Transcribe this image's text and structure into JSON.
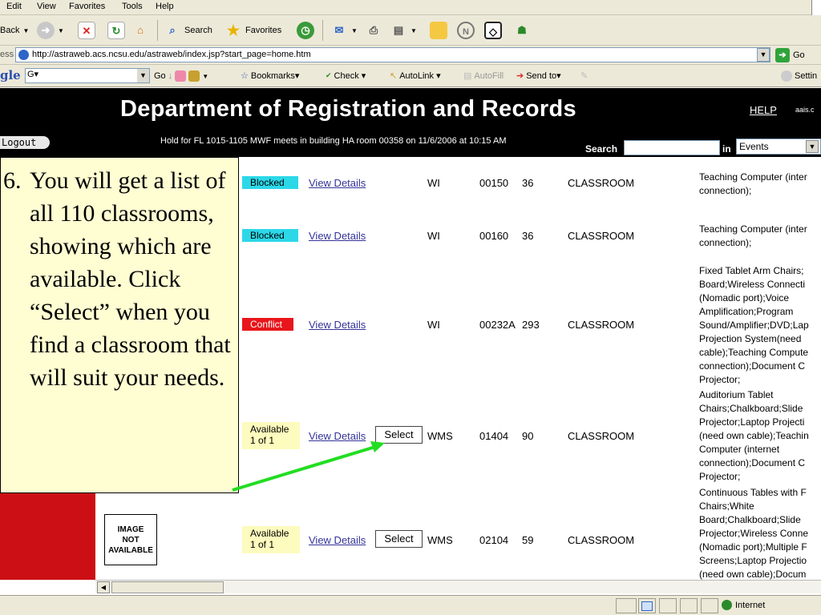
{
  "browser": {
    "menu": [
      "Edit",
      "View",
      "Favorites",
      "Tools",
      "Help"
    ],
    "toolbar": {
      "back": "Back",
      "search": "Search",
      "favorites": "Favorites"
    },
    "address": {
      "label": "ess",
      "url": "http://astraweb.acs.ncsu.edu/astraweb/index.jsp?start_page=home.htm",
      "go": "Go"
    },
    "google": {
      "logo": "gle",
      "box_value": "G▾",
      "go": "Go",
      "bookmarks": "Bookmarks▾",
      "check": "Check ▾",
      "autolink": "AutoLink ▾",
      "autofill": "AutoFill",
      "sendto": "Send to▾",
      "settings": "Settin"
    },
    "status": {
      "zone": "Internet"
    }
  },
  "page": {
    "title": "Department of Registration and Records",
    "help": "HELP",
    "user": "aais.c",
    "logout": "Logout",
    "hold_text": "Hold for FL 1015-1105 MWF meets in building HA room 00358 on  11/6/2006 at 10:15 AM",
    "search_label": "Search",
    "search_value": "",
    "in_label": "in",
    "search_scope": "Events",
    "image_placeholder": "IMAGE\nNOT\nAVAILABLE"
  },
  "rooms": [
    {
      "status": "Blocked",
      "link": "View Details",
      "select": "",
      "building": "WI",
      "room": "00150",
      "capacity": "36",
      "type": "CLASSROOM",
      "amenities": "Teaching Computer (inter\nconnection);"
    },
    {
      "status": "Blocked",
      "link": "View Details",
      "select": "",
      "building": "WI",
      "room": "00160",
      "capacity": "36",
      "type": "CLASSROOM",
      "amenities": "Teaching Computer (inter\nconnection);"
    },
    {
      "status": "Conflict",
      "link": "View Details",
      "select": "",
      "building": "WI",
      "room": "00232A",
      "capacity": "293",
      "type": "CLASSROOM",
      "amenities": "Fixed Tablet Arm Chairs;\nBoard;Wireless Connecti\n(Nomadic port);Voice\nAmplification;Program\nSound/Amplifier;DVD;Lap\nProjection System(need\ncable);Teaching Compute\nconnection);Document C\nProjector;"
    },
    {
      "status": "Available\n1 of 1",
      "link": "View Details",
      "select": "Select",
      "building": "WMS",
      "room": "01404",
      "capacity": "90",
      "type": "CLASSROOM",
      "amenities": "Auditorium Tablet\nChairs;Chalkboard;Slide\nProjector;Laptop Projecti\n(need own cable);Teachin\nComputer (internet\nconnection);Document C\nProjector;"
    },
    {
      "status": "Available\n1 of 1",
      "link": "View Details",
      "select": "Select",
      "building": "WMS",
      "room": "02104",
      "capacity": "59",
      "type": "CLASSROOM",
      "amenities": "Continuous Tables with F\nChairs;White\nBoard;Chalkboard;Slide\nProjector;Wireless Conne\n(Nomadic port);Multiple F\nScreens;Laptop Projectio\n(need own cable);Docum"
    }
  ],
  "callout": {
    "number": "6.",
    "text": "You will get a list of all 110 classrooms, showing which are available. Click “Select” when you find a classroom that will suit your needs."
  },
  "colors": {
    "header_bg": "#000000",
    "sidebar_red": "#cc0f14",
    "blocked": "#2cd8e8",
    "conflict": "#e8161b",
    "available": "#fdfbbd",
    "arrow": "#22dd22",
    "callout_bg": "#fffdd2"
  }
}
